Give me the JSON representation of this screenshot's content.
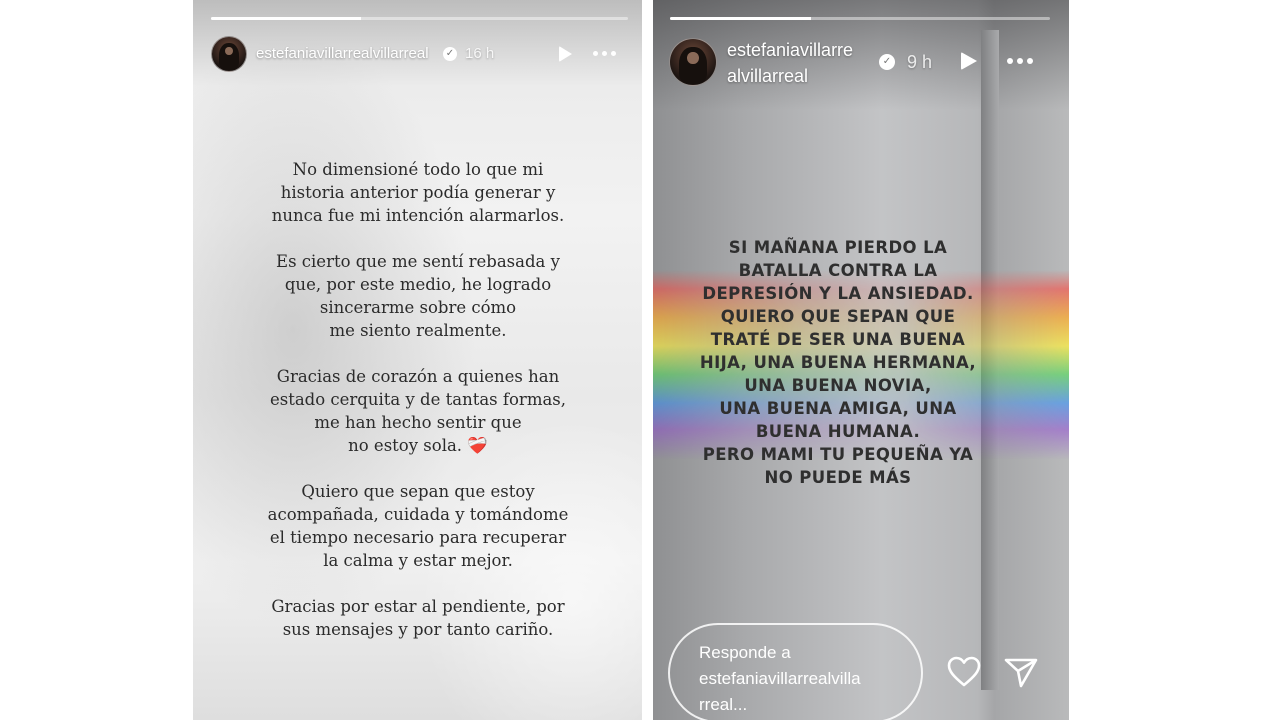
{
  "left_story": {
    "username": "estefaniavillarrealvillarreal",
    "time": "16 h",
    "paragraphs": [
      [
        "No dimensioné todo lo que mi",
        "historia anterior podía generar y",
        "nunca fue mi intención alarmarlos."
      ],
      [
        "Es cierto que me sentí rebasada y",
        "que, por este medio, he logrado",
        "sincerarme sobre cómo",
        "me siento realmente."
      ],
      [
        "Gracias de corazón a quienes han",
        "estado cerquita y de tantas formas,",
        "me han hecho sentir que",
        "no estoy sola."
      ],
      [
        "Quiero que sepan que estoy",
        "acompañada, cuidada y tomándome",
        "el tiempo necesario para recuperar",
        "la calma y estar mejor."
      ],
      [
        "Gracias por estar al pendiente, por",
        "sus mensajes y por tanto cariño."
      ]
    ],
    "heart_emoji": "❤️‍🩹",
    "progress": 0.36
  },
  "right_story": {
    "username_line1": "estefaniavillarre",
    "username_line2": "alvillarreal",
    "time": "9 h",
    "lines": [
      "SI MAÑANA PIERDO LA",
      "BATALLA CONTRA LA",
      "DEPRESIÓN Y LA ANSIEDAD.",
      "QUIERO QUE SEPAN QUE",
      "TRATÉ DE SER UNA BUENA",
      "HIJA, UNA BUENA HERMANA,",
      "UNA BUENA NOVIA,",
      "UNA BUENA AMIGA, UNA",
      "BUENA HUMANA.",
      "PERO MAMI  TU PEQUEÑA YA",
      "NO PUEDE MÁS"
    ],
    "reply_placeholder_lines": [
      "Responde a",
      "estefaniavillarrealvilla",
      "rreal..."
    ],
    "progress": 0.37
  },
  "icons": {
    "verified": "verified-badge-icon",
    "play": "play-icon",
    "more": "more-options-icon",
    "heart": "heart-icon",
    "send": "send-icon"
  }
}
